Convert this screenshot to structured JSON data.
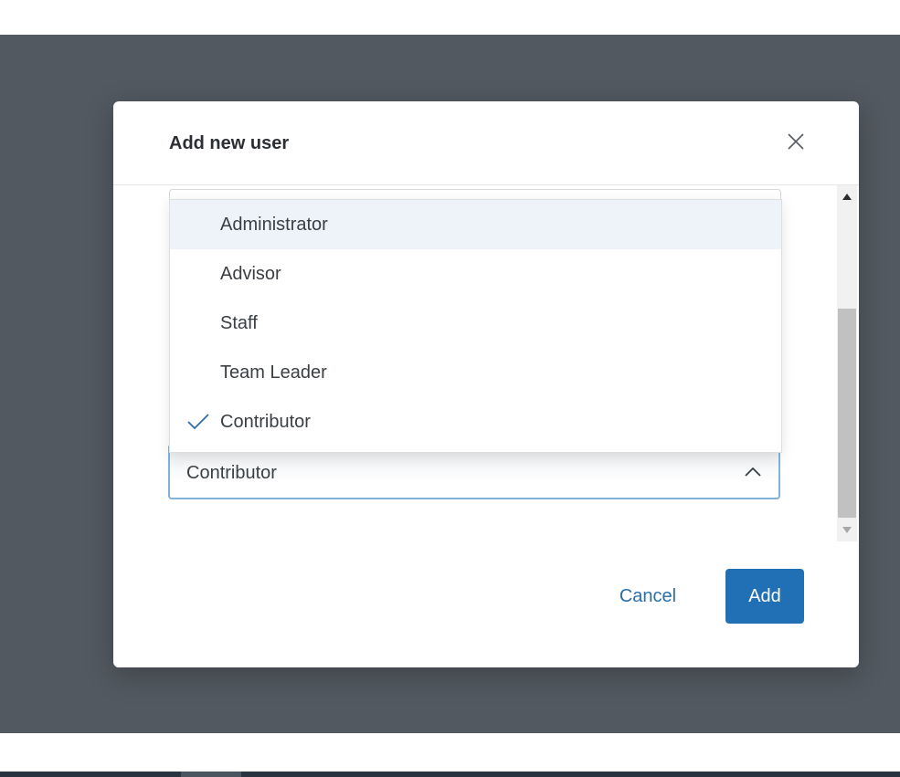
{
  "modal": {
    "title": "Add new user"
  },
  "role_select": {
    "selected_value": "Contributor",
    "options": [
      {
        "label": "Administrator",
        "highlighted": true,
        "selected": false
      },
      {
        "label": "Advisor",
        "highlighted": false,
        "selected": false
      },
      {
        "label": "Staff",
        "highlighted": false,
        "selected": false
      },
      {
        "label": "Team Leader",
        "highlighted": false,
        "selected": false
      },
      {
        "label": "Contributor",
        "highlighted": false,
        "selected": true
      }
    ]
  },
  "footer": {
    "cancel_label": "Cancel",
    "add_label": "Add"
  },
  "colors": {
    "overlay": "#525960",
    "accent": "#2170b5",
    "link": "#2a6ea8",
    "highlight": "#eef3f9",
    "focus_border": "#7fb3dc"
  },
  "icons": {
    "close": "close-icon",
    "check": "check-icon",
    "chevron": "chevron-up-icon"
  }
}
